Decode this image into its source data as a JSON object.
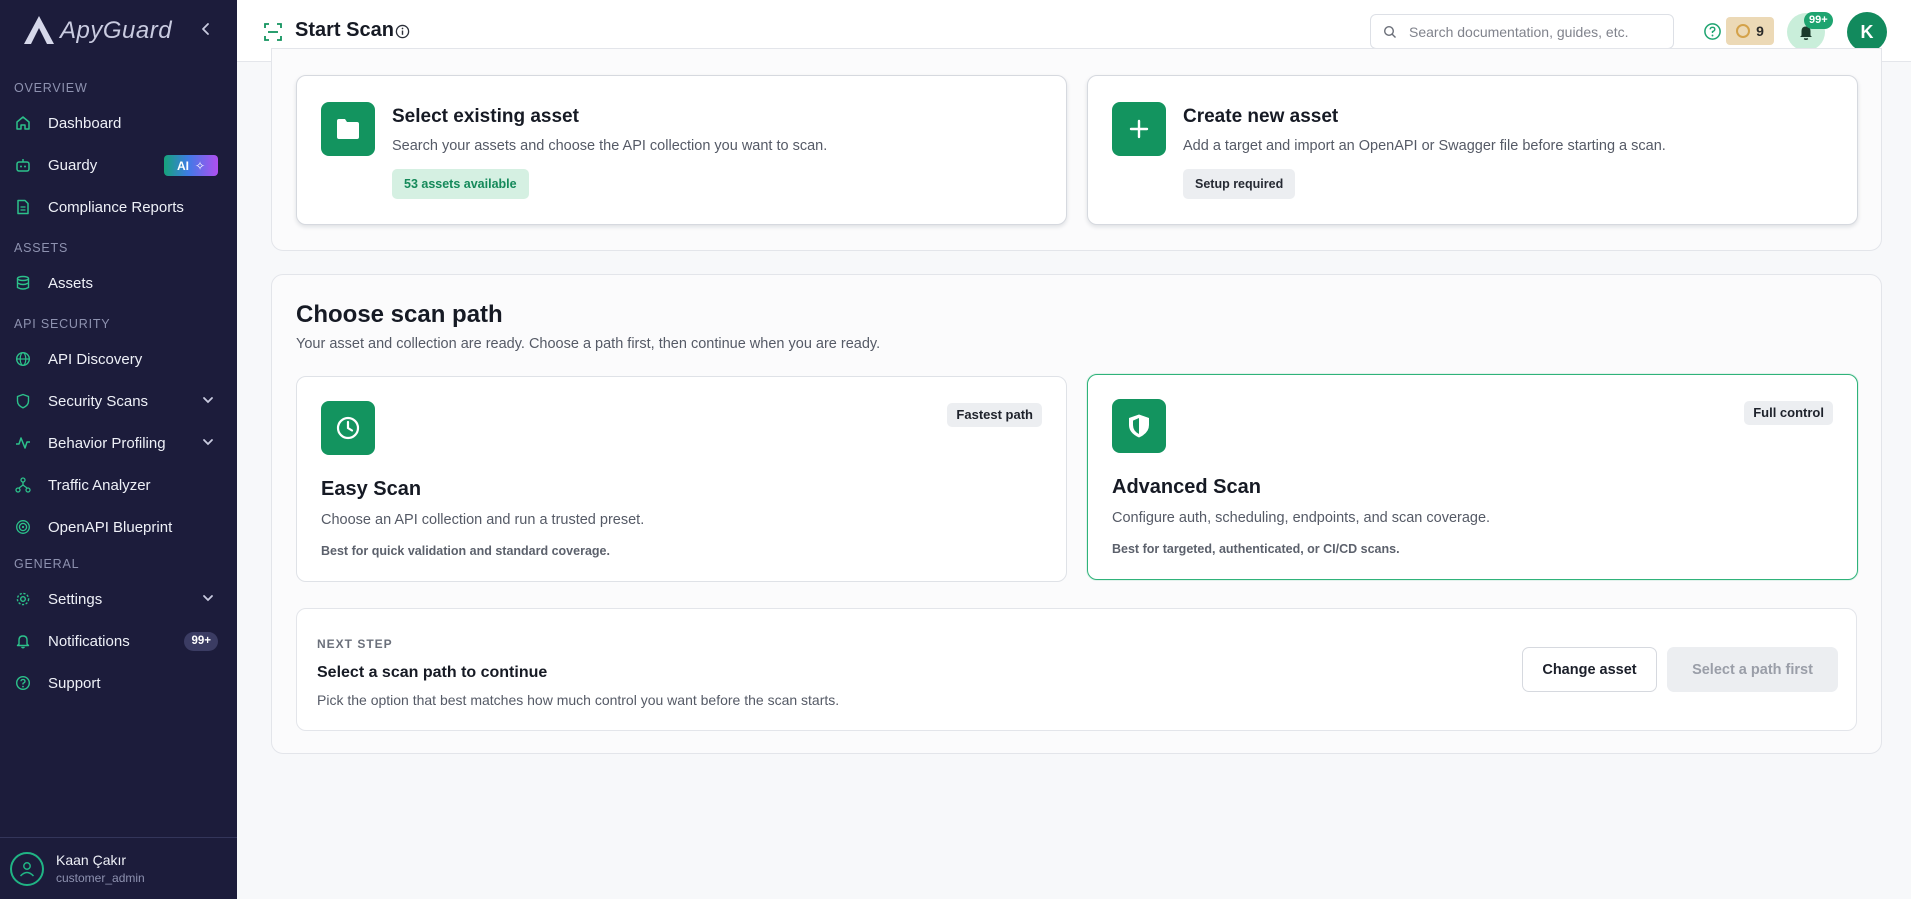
{
  "app": {
    "name": "ApyGuard"
  },
  "sidebar": {
    "sections": {
      "overview": "OVERVIEW",
      "assets": "ASSETS",
      "api_security": "API SECURITY",
      "general": "GENERAL"
    },
    "items": [
      {
        "label": "Dashboard",
        "icon": "home-icon"
      },
      {
        "label": "Guardy",
        "icon": "bot-icon",
        "badge": "AI"
      },
      {
        "label": "Compliance Reports",
        "icon": "document-icon"
      },
      {
        "label": "Assets",
        "icon": "database-icon"
      },
      {
        "label": "API Discovery",
        "icon": "globe-icon"
      },
      {
        "label": "Security Scans",
        "icon": "shield-icon",
        "expandable": true
      },
      {
        "label": "Behavior Profiling",
        "icon": "activity-icon",
        "expandable": true
      },
      {
        "label": "Traffic Analyzer",
        "icon": "network-icon"
      },
      {
        "label": "OpenAPI Blueprint",
        "icon": "fingerprint-icon"
      },
      {
        "label": "Settings",
        "icon": "gear-icon",
        "expandable": true
      },
      {
        "label": "Notifications",
        "icon": "bell-icon",
        "badge": "99+"
      },
      {
        "label": "Support",
        "icon": "help-icon"
      }
    ],
    "user": {
      "name": "Kaan Çakır",
      "role": "customer_admin"
    }
  },
  "header": {
    "title": "Start Scan",
    "search_placeholder": "Search documentation, guides, etc.",
    "credits": "9",
    "notifications_count": "99+",
    "avatar_initial": "K"
  },
  "asset_cards": {
    "existing": {
      "title": "Select existing asset",
      "description": "Search your assets and choose the API collection you want to scan.",
      "pill": "53 assets available"
    },
    "new": {
      "title": "Create new asset",
      "description": "Add a target and import an OpenAPI or Swagger file before starting a scan.",
      "pill": "Setup required"
    }
  },
  "scan_path": {
    "title": "Choose scan path",
    "subtitle": "Your asset and collection are ready. Choose a path first, then continue when you are ready.",
    "easy": {
      "tag": "Fastest path",
      "title": "Easy Scan",
      "description": "Choose an API collection and run a trusted preset.",
      "note": "Best for quick validation and standard coverage."
    },
    "advanced": {
      "tag": "Full control",
      "title": "Advanced Scan",
      "description": "Configure auth, scheduling, endpoints, and scan coverage.",
      "note": "Best for targeted, authenticated, or CI/CD scans.",
      "selected": true
    }
  },
  "next_step": {
    "eyebrow": "NEXT STEP",
    "title": "Select a scan path to continue",
    "description": "Pick the option that best matches how much control you want before the scan starts.",
    "change_asset_label": "Change asset",
    "continue_label": "Select a path first"
  },
  "colors": {
    "sidebar_bg": "#1c1c3b",
    "accent_green": "#13945f",
    "selected_border": "#2fb37a"
  }
}
